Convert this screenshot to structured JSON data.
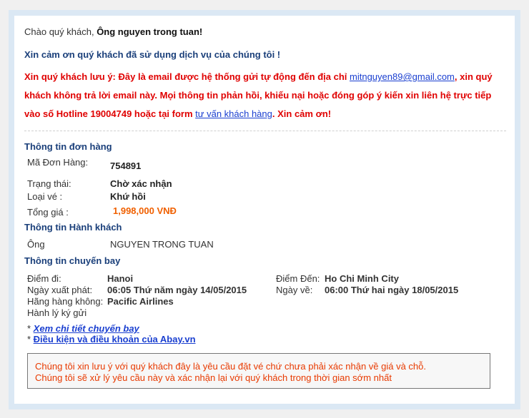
{
  "greeting": {
    "prefix": "Chào quý khách, ",
    "name": "Ông nguyen trong tuan!"
  },
  "thanks": "Xin cảm ơn quý khách đã sử dụng dịch vụ của chúng tôi !",
  "notice": {
    "part1": "Xin quý khách lưu ý: Đây là email được hệ thống gửi tự động đến địa chỉ ",
    "email": "mitnguyen89@gmail.com",
    "part2": ", xin quý khách không trả lời email này. Mọi thông tin phản hồi, khiếu nại hoặc đóng góp ý kiến xin liên hệ trực tiếp vào số Hotline 19004749 hoặc tại form ",
    "link": "tư vấn khách hàng",
    "part3": ". Xin cảm ơn!"
  },
  "order": {
    "title": "Thông tin đơn hàng",
    "code_label": "Mã Đơn Hàng:",
    "code_value": "754891",
    "status_label": "Trạng thái:",
    "status_value": "Chờ xác nhận",
    "ticket_label": "Loại vé :",
    "ticket_value": "Khứ hồi",
    "total_label": "Tổng giá :",
    "total_value": "1,998,000 VNĐ"
  },
  "passenger": {
    "title": "Thông tin Hành khách",
    "salutation": "Ông",
    "name": "NGUYEN TRONG TUAN"
  },
  "flight": {
    "title": "Thông tin chuyến bay",
    "from_label": "Điểm đi:",
    "from_value": "Hanoi",
    "to_label": "Điểm Đến:",
    "to_value": "Ho Chi Minh City",
    "depart_label": "Ngày xuất phát:",
    "depart_value": "06:05 Thứ năm ngày 14/05/2015",
    "return_label": "Ngày về:",
    "return_value": "06:00 Thứ hai ngày 18/05/2015",
    "airline_label": "Hãng hàng không:",
    "airline_value": "Pacific Airlines",
    "baggage_label": "Hành lý ký gửi"
  },
  "links": {
    "bullet": "* ",
    "details": "Xem chi tiết chuyến bay",
    "terms": "Điều kiện và điều khoản của Abay.vn"
  },
  "warning": {
    "line1": "Chúng tôi xin lưu ý với quý khách đây là yêu cầu đặt vé chứ chưa phải xác nhận về giá và chỗ.",
    "line2": "Chúng tôi sẽ xử lý yêu cầu này và xác nhận lại với quý khách trong thời gian sớm nhất"
  }
}
